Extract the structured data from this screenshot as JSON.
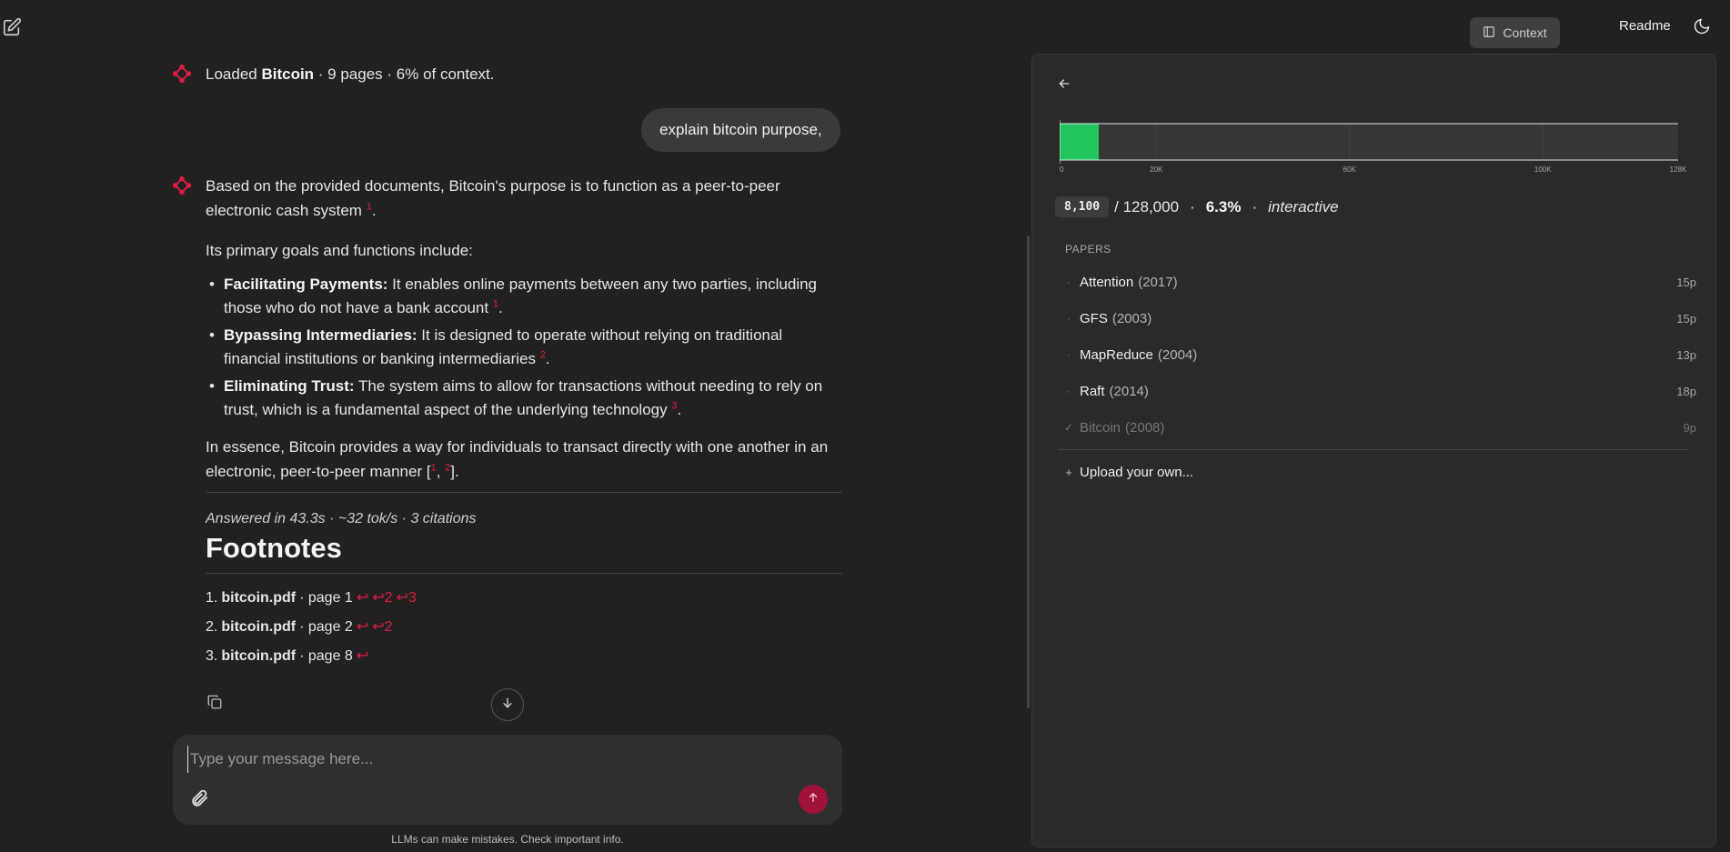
{
  "topbar": {
    "context_label": "Context",
    "readme_label": "Readme"
  },
  "status_message": {
    "prefix": "Loaded ",
    "doc": "Bitcoin",
    "suffix": " · 9 pages · 6% of context."
  },
  "user_message": "explain bitcoin purpose,",
  "answer": {
    "intro_1": "Based on the provided documents, Bitcoin's purpose is to function as a peer-to-peer electronic cash system ",
    "intro_cite": "1",
    "intro_end": ".",
    "goals_heading": "Its primary goals and functions include:",
    "goals": [
      {
        "title": "Facilitating Payments:",
        "text": " It enables online payments between any two parties, including those who do not have a bank account ",
        "cite": "1"
      },
      {
        "title": "Bypassing Intermediaries:",
        "text": " It is designed to operate without relying on traditional financial institutions or banking intermediaries ",
        "cite": "2"
      },
      {
        "title": "Eliminating Trust:",
        "text": " The system aims to allow for transactions without needing to rely on trust, which is a fundamental aspect of the underlying technology ",
        "cite": "3"
      }
    ],
    "essence_1": "In essence, Bitcoin provides a way for individuals to transact directly with one another in an electronic, peer-to-peer manner [",
    "essence_cite_a": "1",
    "essence_sep": ", ",
    "essence_cite_b": "2",
    "essence_end": "].",
    "answered_meta": "Answered in 43.3s · ~32 tok/s · 3 citations",
    "footnotes_heading": "Footnotes",
    "footnotes": [
      {
        "num": "1.",
        "file": "bitcoin.pdf",
        "page": " · page 1",
        "backrefs": [
          "↩",
          "↩2",
          "↩3"
        ]
      },
      {
        "num": "2.",
        "file": "bitcoin.pdf",
        "page": " · page 2",
        "backrefs": [
          "↩",
          "↩2"
        ]
      },
      {
        "num": "3.",
        "file": "bitcoin.pdf",
        "page": " · page 8",
        "backrefs": [
          "↩"
        ]
      }
    ]
  },
  "composer": {
    "placeholder": "Type your message here...",
    "disclaimer": "LLMs can make mistakes. Check important info."
  },
  "context_panel": {
    "tokens": "8,100",
    "total": "/ 128,000",
    "percent": "6.3%",
    "mode": "interactive",
    "papers_label": "PAPERS",
    "papers": [
      {
        "name": "Attention",
        "year": "(2017)",
        "pages": "15p",
        "loaded": false
      },
      {
        "name": "GFS",
        "year": "(2003)",
        "pages": "15p",
        "loaded": false
      },
      {
        "name": "MapReduce",
        "year": "(2004)",
        "pages": "13p",
        "loaded": false
      },
      {
        "name": "Raft",
        "year": "(2014)",
        "pages": "18p",
        "loaded": false
      },
      {
        "name": "Bitcoin",
        "year": "(2008)",
        "pages": "9p",
        "loaded": true
      }
    ],
    "upload_label": "Upload your own..."
  },
  "chart_data": {
    "type": "bar",
    "orientation": "horizontal",
    "value": 8100,
    "xlim": [
      0,
      128000
    ],
    "ticks": [
      0,
      20000,
      60000,
      100000,
      128000
    ],
    "tick_labels": [
      "0",
      "20K",
      "60K",
      "100K",
      "128K"
    ],
    "bar_color": "#22c55e"
  },
  "colors": {
    "accent": "#e11d48",
    "send_button": "#9f1239",
    "context_fill": "#22c55e"
  }
}
